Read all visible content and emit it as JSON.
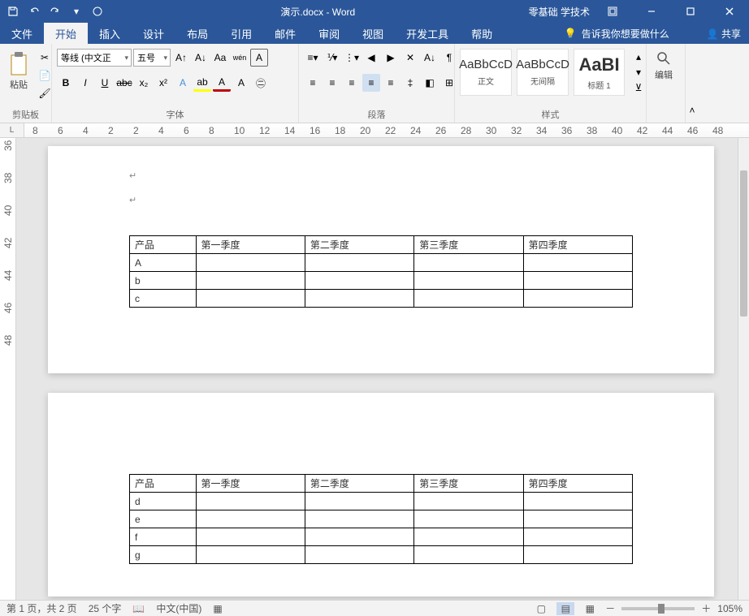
{
  "title_doc": "演示.docx - Word",
  "title_brand": "零基础 学技术",
  "tabs": {
    "file": "文件",
    "home": "开始",
    "insert": "插入",
    "design": "设计",
    "layout": "布局",
    "refs": "引用",
    "mail": "邮件",
    "review": "审阅",
    "view": "视图",
    "dev": "开发工具",
    "help": "帮助",
    "tellme": "告诉我你想要做什么",
    "share": "共享"
  },
  "ribbon": {
    "clipboard": {
      "label": "剪贴板",
      "paste": "粘贴"
    },
    "font": {
      "label": "字体",
      "name": "等线 (中文正",
      "size": "五号"
    },
    "para": {
      "label": "段落"
    },
    "styles": {
      "label": "样式",
      "s1": "正文",
      "s2": "无间隔",
      "s3": "标题 1",
      "preview": "AaBbCcD",
      "preview_big": "AaBI"
    },
    "edit": {
      "label": "编辑"
    }
  },
  "ruler_corner": "L",
  "hruler_nums": [
    8,
    6,
    4,
    2,
    2,
    4,
    6,
    8,
    10,
    12,
    14,
    16,
    18,
    20,
    22,
    24,
    26,
    28,
    30,
    32,
    34,
    36,
    38,
    40,
    42,
    44,
    46,
    48
  ],
  "vruler_nums": [
    36,
    38,
    40,
    42,
    44,
    46,
    48
  ],
  "table": {
    "headers": [
      "产品",
      "第一季度",
      "第二季度",
      "第三季度",
      "第四季度"
    ],
    "page1_rows": [
      "A",
      "b",
      "c"
    ],
    "page2_rows": [
      "d",
      "e",
      "f",
      "g"
    ]
  },
  "status": {
    "page": "第 1 页，共 2 页",
    "words": "25 个字",
    "lang": "中文(中国)",
    "zoom": "105%"
  }
}
